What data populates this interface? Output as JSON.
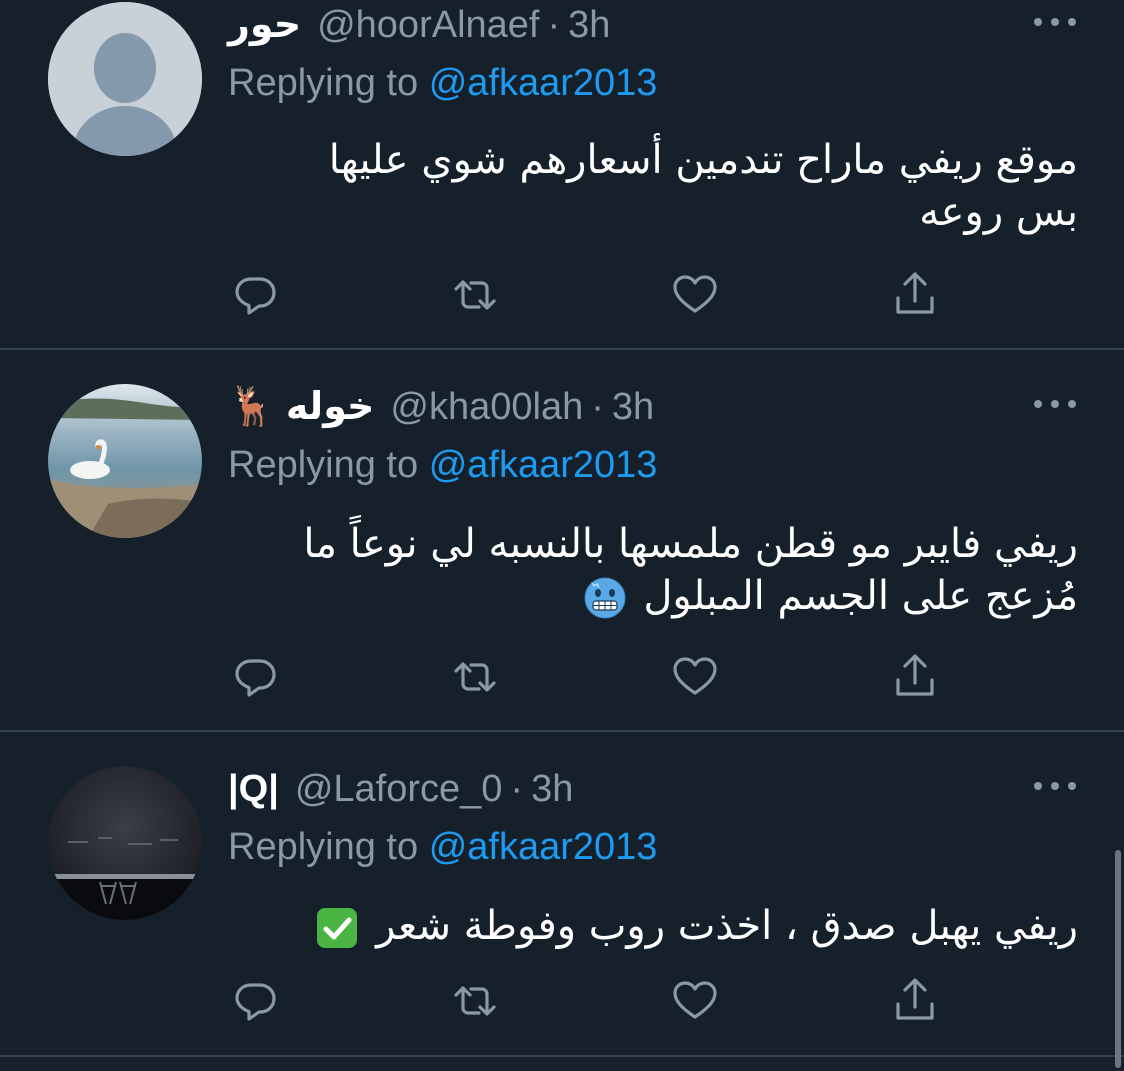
{
  "tweets": [
    {
      "name": "حور",
      "handle": "@hoorAlnaef",
      "time": "3h",
      "reply_prefix": "Replying to",
      "reply_to": "@afkaar2013",
      "lines": [
        "موقع ريفي ماراح تندمين أسعارهم شوي عليها",
        "بس روعه"
      ],
      "avatar": "default-avatar"
    },
    {
      "name": "خوله",
      "name_emoji": "🦌",
      "handle": "@kha00lah",
      "time": "3h",
      "reply_prefix": "Replying to",
      "reply_to": "@afkaar2013",
      "lines": [
        "ريفي فايبر مو قطن ملمسها بالنسبه لي نوعاً ما",
        "مُزعج على الجسم المبلول"
      ],
      "line2_emoji": "cold-face",
      "avatar": "swan-photo"
    },
    {
      "name": "|Q|",
      "handle": "@Laforce_0",
      "time": "3h",
      "reply_prefix": "Replying to",
      "reply_to": "@afkaar2013",
      "lines": [
        "ريفي يهبل صدق ، اخذت روب وفوطة شعر"
      ],
      "line1_emoji": "check-mark",
      "avatar": "night-photo"
    }
  ],
  "colors": {
    "background": "#15202b",
    "divider": "#38444d",
    "secondary_text": "#8b98a5",
    "mention": "#1d9bf0"
  }
}
